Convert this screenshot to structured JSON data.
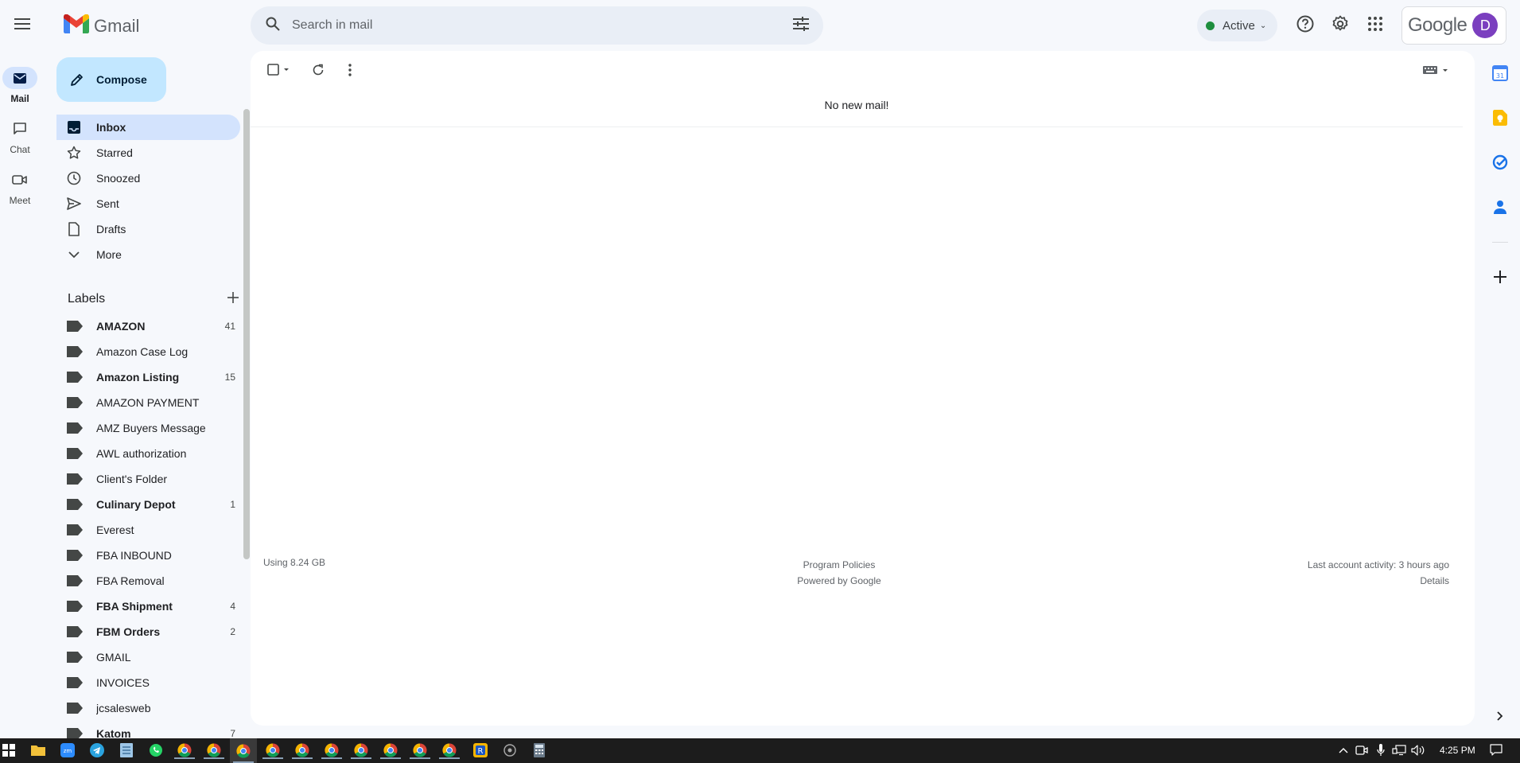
{
  "app": {
    "name": "Gmail"
  },
  "search": {
    "placeholder": "Search in mail"
  },
  "status": {
    "label": "Active",
    "color": "#1e8e3e"
  },
  "account": {
    "brand": "Google",
    "avatar_initial": "D",
    "avatar_color": "#7b3fbf"
  },
  "rail": [
    {
      "label": "Mail",
      "icon": "mail-icon",
      "active": true
    },
    {
      "label": "Chat",
      "icon": "chat-icon",
      "active": false
    },
    {
      "label": "Meet",
      "icon": "video-icon",
      "active": false
    }
  ],
  "compose": {
    "label": "Compose"
  },
  "nav_items": [
    {
      "label": "Inbox",
      "icon": "inbox-icon",
      "active": true
    },
    {
      "label": "Starred",
      "icon": "star-icon",
      "active": false
    },
    {
      "label": "Snoozed",
      "icon": "clock-icon",
      "active": false
    },
    {
      "label": "Sent",
      "icon": "send-icon",
      "active": false
    },
    {
      "label": "Drafts",
      "icon": "draft-icon",
      "active": false
    },
    {
      "label": "More",
      "icon": "chevron-down-icon",
      "active": false
    }
  ],
  "labels": {
    "heading": "Labels",
    "items": [
      {
        "name": "AMAZON",
        "count": "41",
        "bold": true
      },
      {
        "name": "Amazon Case Log",
        "count": "",
        "bold": false
      },
      {
        "name": "Amazon Listing",
        "count": "15",
        "bold": true
      },
      {
        "name": "AMAZON PAYMENT",
        "count": "",
        "bold": false
      },
      {
        "name": "AMZ Buyers Message",
        "count": "",
        "bold": false
      },
      {
        "name": "AWL authorization",
        "count": "",
        "bold": false
      },
      {
        "name": "Client's Folder",
        "count": "",
        "bold": false
      },
      {
        "name": "Culinary Depot",
        "count": "1",
        "bold": true
      },
      {
        "name": "Everest",
        "count": "",
        "bold": false
      },
      {
        "name": "FBA INBOUND",
        "count": "",
        "bold": false
      },
      {
        "name": "FBA Removal",
        "count": "",
        "bold": false
      },
      {
        "name": "FBA Shipment",
        "count": "4",
        "bold": true
      },
      {
        "name": "FBM Orders",
        "count": "2",
        "bold": true
      },
      {
        "name": "GMAIL",
        "count": "",
        "bold": false
      },
      {
        "name": "INVOICES",
        "count": "",
        "bold": false
      },
      {
        "name": "jcsalesweb",
        "count": "",
        "bold": false
      },
      {
        "name": "Katom",
        "count": "7",
        "bold": true
      }
    ]
  },
  "main": {
    "empty_message": "No new mail!",
    "storage": "Using 8.24 GB",
    "program_policies": "Program Policies",
    "powered_by": "Powered by Google",
    "last_activity": "Last account activity: 3 hours ago",
    "details": "Details"
  },
  "taskbar": {
    "time": "4:25 PM"
  }
}
